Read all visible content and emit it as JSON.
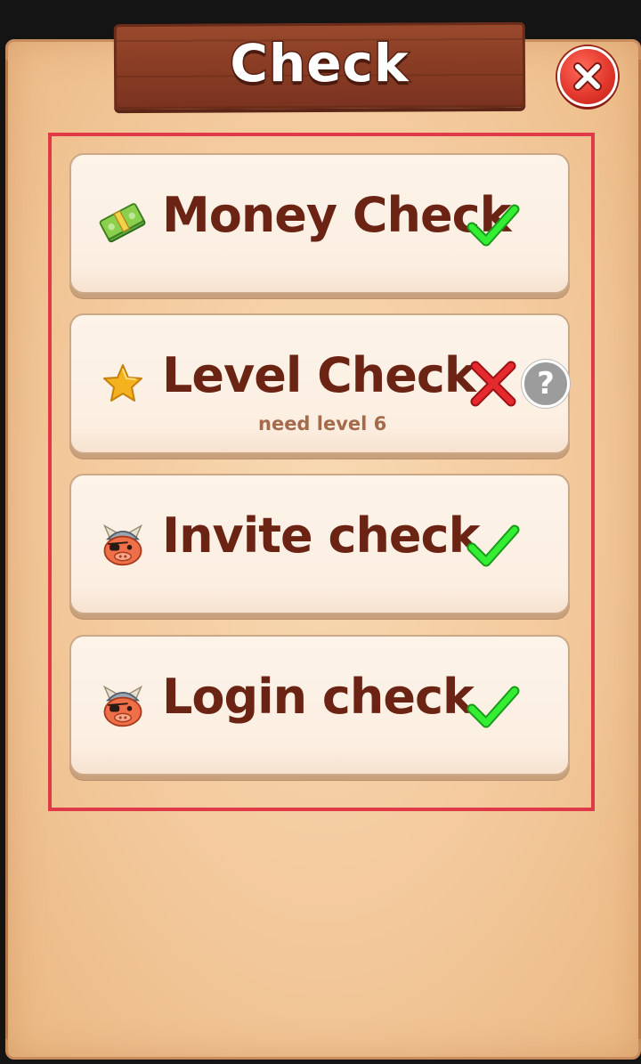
{
  "dialog": {
    "title": "Check",
    "close_icon": "close-icon"
  },
  "checks": [
    {
      "label": "Money Check",
      "icon": "money-icon",
      "status": "passed",
      "status_icon": "check-mark-icon"
    },
    {
      "label": "Level Check",
      "icon": "star-icon",
      "status": "failed",
      "status_icon": "cross-mark-icon",
      "sublabel": "need level 6",
      "help_label": "?"
    },
    {
      "label": "Invite check",
      "icon": "viking-mascot-icon",
      "status": "passed",
      "status_icon": "check-mark-icon"
    },
    {
      "label": "Login check",
      "icon": "viking-mascot-icon",
      "status": "passed",
      "status_icon": "check-mark-icon"
    }
  ],
  "colors": {
    "parchment": "#f3c99c",
    "plank": "#8a3d24",
    "label": "#6b2414",
    "highlight": "#e03a48",
    "check": "#2ee82e",
    "cross": "#d8262a",
    "close": "#e0352a"
  }
}
